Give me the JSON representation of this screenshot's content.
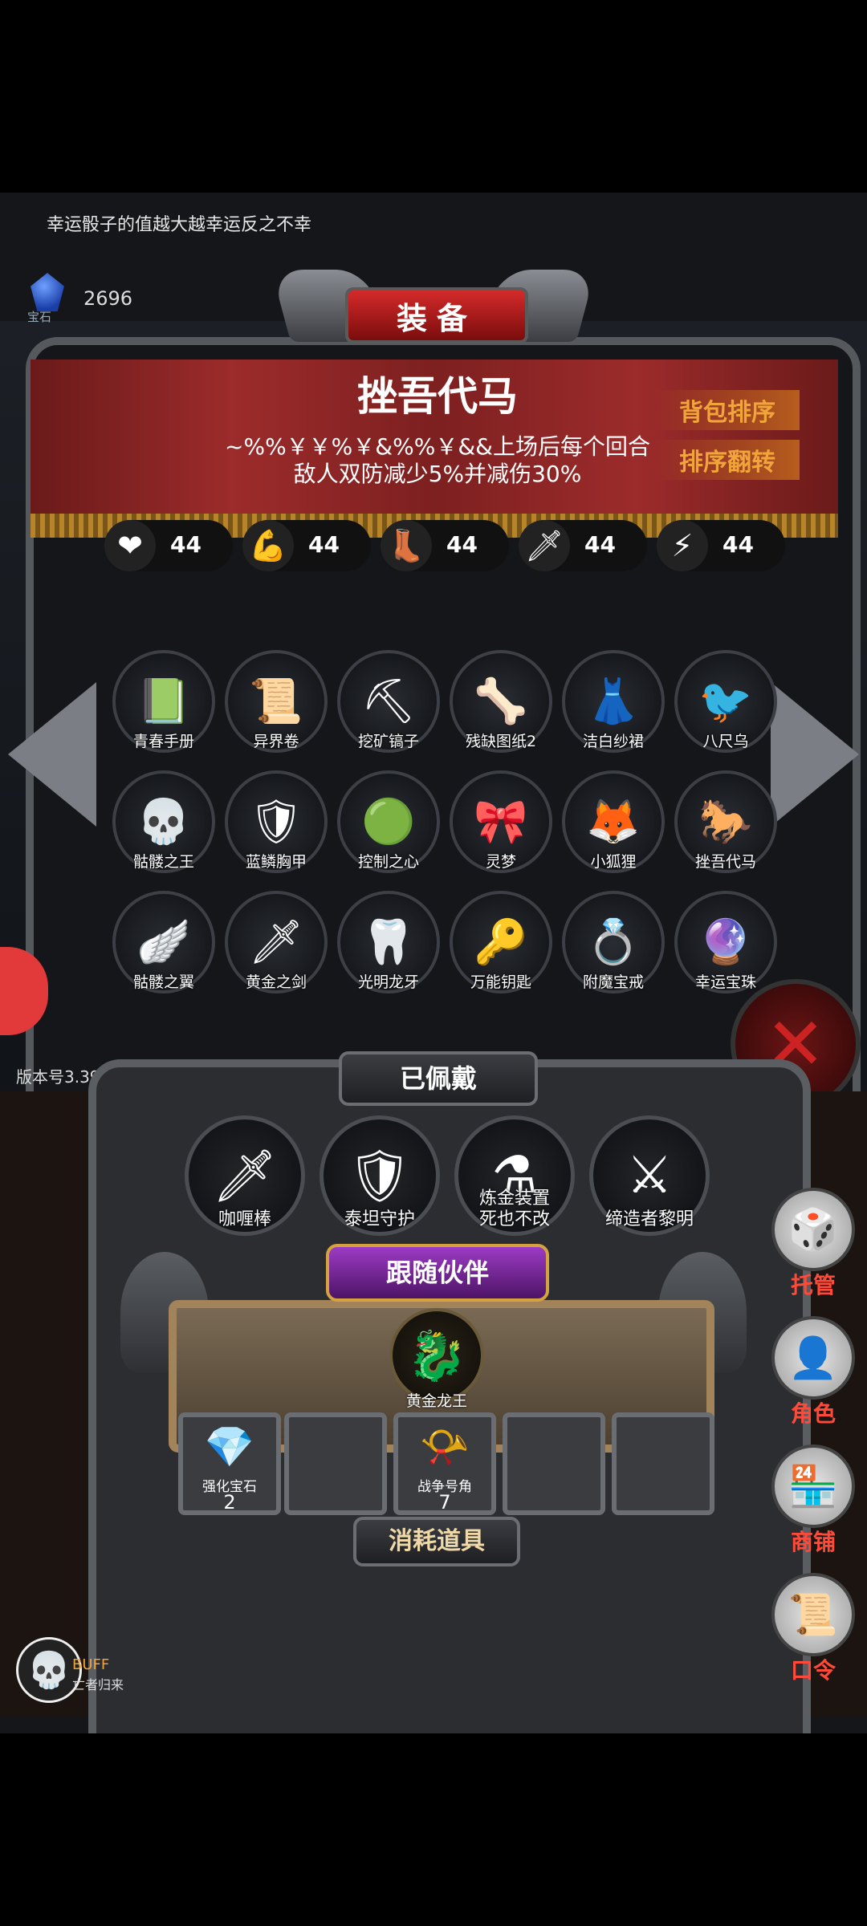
{
  "tip": "幸运骰子的值越大越幸运反之不幸",
  "currency": {
    "icon": "blue-gem-icon",
    "label": "宝石",
    "amount": "2696"
  },
  "title": "装备",
  "selected": {
    "name": "挫吾代马",
    "desc": "~%%￥￥%￥&%%￥&&上场后每个回合敌人双防减少5%并减伤30%"
  },
  "sort_buttons": {
    "sort": "背包排序",
    "reverse": "排序翻转"
  },
  "stats": [
    {
      "icon": "heart-icon",
      "glyph": "❤",
      "value": "44"
    },
    {
      "icon": "strength-icon",
      "glyph": "💪",
      "value": "44"
    },
    {
      "icon": "boot-icon",
      "glyph": "👢",
      "value": "44"
    },
    {
      "icon": "sword-icon",
      "glyph": "🗡",
      "value": "44"
    },
    {
      "icon": "lightning-icon",
      "glyph": "⚡",
      "value": "44"
    }
  ],
  "items": [
    {
      "label": "青春手册",
      "glyph": "📗"
    },
    {
      "label": "异界卷",
      "glyph": "📜"
    },
    {
      "label": "挖矿镐子",
      "glyph": "⛏"
    },
    {
      "label": "残缺图纸2",
      "glyph": "🦴"
    },
    {
      "label": "洁白纱裙",
      "glyph": "👗"
    },
    {
      "label": "八尺乌",
      "glyph": "🐦"
    },
    {
      "label": "骷髅之王",
      "glyph": "💀"
    },
    {
      "label": "蓝鳞胸甲",
      "glyph": "🛡"
    },
    {
      "label": "控制之心",
      "glyph": "🟢"
    },
    {
      "label": "灵梦",
      "glyph": "🎀"
    },
    {
      "label": "小狐狸",
      "glyph": "🦊"
    },
    {
      "label": "挫吾代马",
      "glyph": "🐎"
    },
    {
      "label": "骷髅之翼",
      "glyph": "🪽"
    },
    {
      "label": "黄金之剑",
      "glyph": "🗡"
    },
    {
      "label": "光明龙牙",
      "glyph": "🦷"
    },
    {
      "label": "万能钥匙",
      "glyph": "🔑"
    },
    {
      "label": "附魔宝戒",
      "glyph": "💍"
    },
    {
      "label": "幸运宝珠",
      "glyph": "🔮"
    }
  ],
  "version": "版本号3.39",
  "equipped": {
    "title": "已佩戴",
    "slots": [
      {
        "label": "咖喱棒",
        "glyph": "🗡"
      },
      {
        "label": "泰坦守护",
        "glyph": "🛡"
      },
      {
        "label": "炼金装置\n死也不改",
        "glyph": "⚗"
      },
      {
        "label": "缔造者黎明",
        "glyph": "⚔"
      }
    ]
  },
  "companion": {
    "title": "跟随伙伴",
    "label": "黄金龙王",
    "glyph": "🐉"
  },
  "consumables": {
    "title": "消耗道具",
    "slots": [
      {
        "label": "强化宝石",
        "count": "2",
        "glyph": "💎"
      },
      {
        "label": "",
        "count": "",
        "glyph": ""
      },
      {
        "label": "战争号角",
        "count": "7",
        "glyph": "📯"
      },
      {
        "label": "",
        "count": "",
        "glyph": ""
      },
      {
        "label": "",
        "count": "",
        "glyph": ""
      }
    ]
  },
  "side_menu": [
    {
      "label": "托管",
      "icon": "dice-icon",
      "glyph": "🎲"
    },
    {
      "label": "角色",
      "icon": "hooded-figure-icon",
      "glyph": "👤"
    },
    {
      "label": "商铺",
      "icon": "shop-icon",
      "glyph": "🏪"
    },
    {
      "label": "口令",
      "icon": "scroll-icon",
      "glyph": "📜"
    }
  ],
  "buff": {
    "title": "BUFF",
    "name": "亡者归来"
  }
}
